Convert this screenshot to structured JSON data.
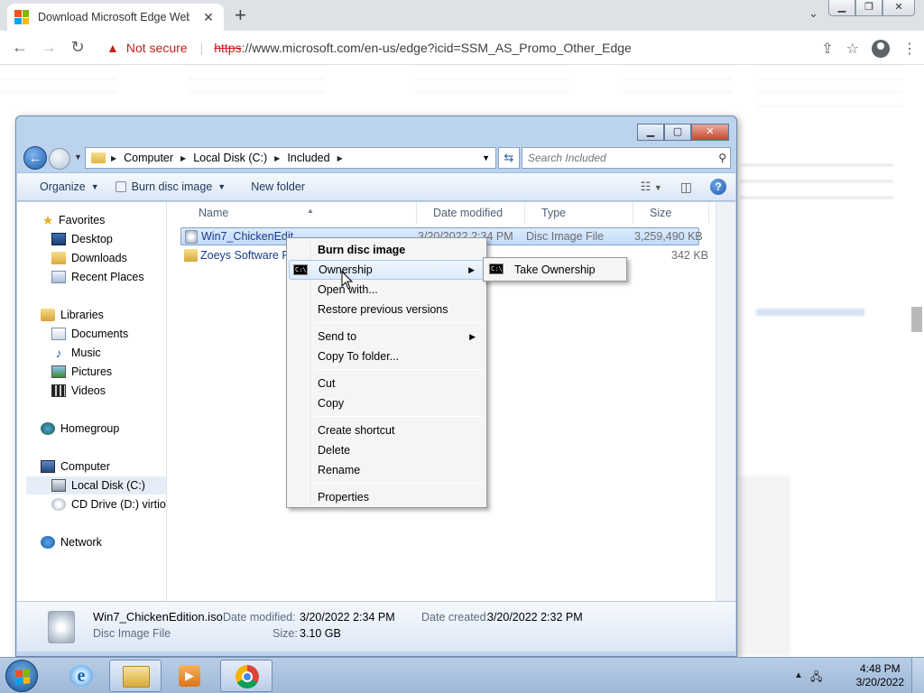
{
  "browser": {
    "tab_title": "Download Microsoft Edge Web B",
    "not_secure": "Not secure",
    "url_scheme": "https",
    "url_rest": "://www.microsoft.com/en-us/edge?icid=SSM_AS_Promo_Other_Edge"
  },
  "explorer": {
    "breadcrumb": [
      "Computer",
      "Local Disk (C:)",
      "Included"
    ],
    "search_placeholder": "Search Included",
    "toolbar": {
      "organize": "Organize",
      "burn": "Burn disc image",
      "new_folder": "New folder"
    },
    "nav": {
      "favorites": "Favorites",
      "desktop": "Desktop",
      "downloads": "Downloads",
      "recent": "Recent Places",
      "libraries": "Libraries",
      "documents": "Documents",
      "music": "Music",
      "pictures": "Pictures",
      "videos": "Videos",
      "homegroup": "Homegroup",
      "computer": "Computer",
      "local_disk": "Local Disk (C:)",
      "cd_drive": "CD Drive (D:) virtio-w",
      "network": "Network"
    },
    "columns": [
      "Name",
      "Date modified",
      "Type",
      "Size"
    ],
    "files": [
      {
        "name": "Win7_ChickenEdit",
        "date": "3/20/2022 2:34 PM",
        "type": "Disc Image File",
        "size": "3,259,490 KB"
      },
      {
        "name": "Zoeys Software Pa",
        "date": "",
        "type": "",
        "size": "342 KB"
      }
    ],
    "details": {
      "filename": "Win7_ChickenEdition.iso",
      "filetype": "Disc Image File",
      "modified_label": "Date modified:",
      "modified_value": "3/20/2022 2:34 PM",
      "created_label": "Date created:",
      "created_value": "3/20/2022 2:32 PM",
      "size_label": "Size:",
      "size_value": "3.10 GB"
    }
  },
  "context_menu": {
    "items": [
      "Burn disc image",
      "Ownership",
      "Open with...",
      "Restore previous versions",
      "Send to",
      "Copy To folder...",
      "Cut",
      "Copy",
      "Create shortcut",
      "Delete",
      "Rename",
      "Properties"
    ],
    "submenu_item": "Take Ownership"
  },
  "taskbar": {
    "time": "4:48 PM",
    "date": "3/20/2022"
  }
}
